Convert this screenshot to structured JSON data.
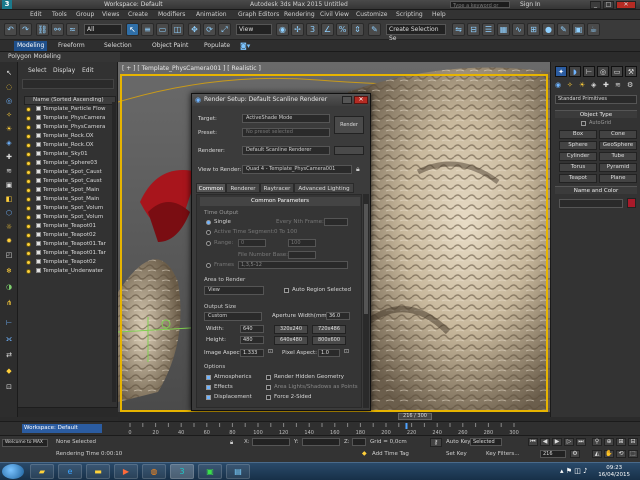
{
  "window": {
    "title": "Autodesk 3ds Max 2015   Untitled",
    "workspace": "Workspace: Default",
    "search_placeholder": "Type a keyword or phrase",
    "sign_in": "Sign In"
  },
  "menubar": [
    "Edit",
    "Tools",
    "Group",
    "Views",
    "Create",
    "Modifiers",
    "Animation",
    "Graph Editors",
    "Rendering",
    "Civil View",
    "Customize",
    "Scripting",
    "Help"
  ],
  "toolbar": {
    "filter": "All",
    "view": "View",
    "selection_set": "Create Selection Se"
  },
  "ribbon": {
    "tabs": [
      "Modeling",
      "Freeform",
      "Selection",
      "Object Paint",
      "Populate"
    ],
    "active_tab": "Modeling",
    "subtab": "Polygon Modeling"
  },
  "explorer": {
    "menus": [
      "Select",
      "Display",
      "Edit"
    ],
    "column_header": "Name (Sorted Ascending)",
    "items": [
      "Template_Particle Flow",
      "Template_PhysCamera",
      "Template_PhysCamera",
      "Template_Rock.OX",
      "Template_Rock.OX",
      "Template_Sky01",
      "Template_Sphere03",
      "Template_Spot_Caust",
      "Template_Spot_Caust",
      "Template_Spot_Main",
      "Template_Spot_Main",
      "Template_Spot_Volum",
      "Template_Spot_Volum",
      "Template_Teapot01",
      "Template_Teapot02",
      "Template_Teapot01.Tar",
      "Template_Teapot01.Tar",
      "Template_Teapot02",
      "Template_Underwater"
    ]
  },
  "viewport": {
    "label": "[ + ] [ Template_PhysCamera001 ] [ Realistic ]"
  },
  "command_panel": {
    "dropdown": "Standard Primitives",
    "object_type_header": "Object Type",
    "autogrid": "AutoGrid",
    "buttons": [
      "Box",
      "Cone",
      "Sphere",
      "GeoSphere",
      "Cylinder",
      "Tube",
      "Torus",
      "Pyramid",
      "Teapot",
      "Plane"
    ],
    "name_color_header": "Name and Color"
  },
  "render_dialog": {
    "title": "Render Setup: Default Scanline Renderer",
    "target_label": "Target:",
    "target_value": "ActiveShade Mode",
    "preset_label": "Preset:",
    "preset_value": "No preset selected",
    "renderer_label": "Renderer:",
    "renderer_value": "Default Scanline Renderer",
    "render_button": "Render",
    "view_label": "View to Render:",
    "view_value": "Quad 4 - Template_PhysCamera001",
    "tabs": [
      "Common",
      "Renderer",
      "Raytracer",
      "Advanced Lighting"
    ],
    "active_tab": "Common",
    "rollout_title": "Common Parameters",
    "time_output": "Time Output",
    "single": "Single",
    "every_nth": "Every Nth Frame:",
    "active_segment": "Active Time Segment:",
    "active_segment_value": "0 To 100",
    "range": "Range:",
    "range_from": "0",
    "range_to": "100",
    "file_number_base": "File Number Base:",
    "frames": "Frames",
    "frames_value": "1,3,5-12",
    "area_label": "Area to Render",
    "area_value": "View",
    "auto_region": "Auto Region Selected",
    "output_size": "Output Size",
    "output_preset": "Custom",
    "aperture_label": "Aperture Width(mm):",
    "aperture_value": "36.0",
    "width_label": "Width:",
    "width_value": "640",
    "height_label": "Height:",
    "height_value": "480",
    "size_presets": [
      "320x240",
      "720x486",
      "640x480",
      "800x600"
    ],
    "image_aspect_label": "Image Aspect:",
    "image_aspect_value": "1.333",
    "pixel_aspect_label": "Pixel Aspect:",
    "pixel_aspect_value": "1.0",
    "options_label": "Options",
    "opt_atmospherics": "Atmospherics",
    "opt_render_hidden": "Render Hidden Geometry",
    "opt_effects": "Effects",
    "opt_area_lights": "Area Lights/Shadows as Points",
    "opt_displacement": "Displacement",
    "opt_force2sided": "Force 2-Sided"
  },
  "timeline": {
    "slider": "216 / 300",
    "ticks": [
      "0",
      "10",
      "20",
      "30",
      "40",
      "50",
      "60",
      "70",
      "80",
      "90",
      "100",
      "110",
      "120",
      "130",
      "140",
      "150",
      "160",
      "170",
      "180",
      "190",
      "200",
      "210",
      "220",
      "230",
      "240",
      "250",
      "260",
      "270",
      "280",
      "290",
      "300"
    ]
  },
  "status": {
    "workspace": "Workspace: Default",
    "selection": "None Selected",
    "rendering_time": "Rendering Time 0:00:10",
    "welcome": "Welcome to MAX",
    "x_label": "X:",
    "y_label": "Y:",
    "z_label": "Z:",
    "grid": "Grid = 0,0cm",
    "add_time_tag": "Add Time Tag",
    "auto_key": "Auto Key",
    "set_key": "Set Key",
    "selected": "Selected",
    "key_filters": "Key Filters...",
    "frame": "216"
  },
  "taskbar": {
    "time": "09:23",
    "date": "16/04/2015"
  },
  "colors": {
    "viewport_border": "#e7b400",
    "selection_blue": "#2b5ca1",
    "dialog_close": "#b52b23"
  }
}
